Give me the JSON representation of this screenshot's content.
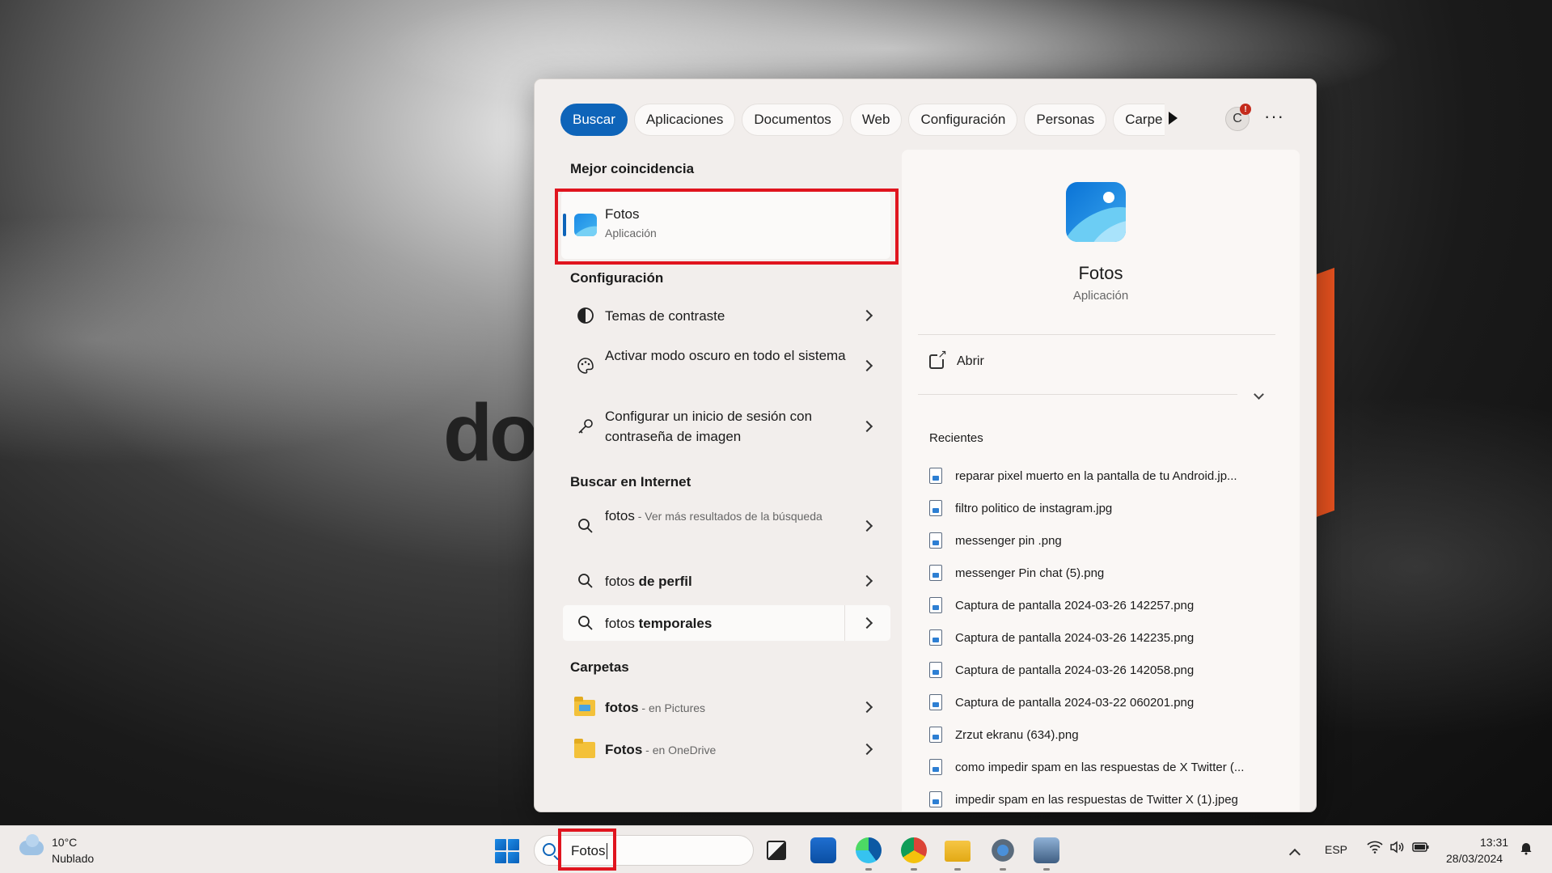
{
  "tabs": [
    {
      "label": "Buscar",
      "active": true
    },
    {
      "label": "Aplicaciones",
      "active": false
    },
    {
      "label": "Documentos",
      "active": false
    },
    {
      "label": "Web",
      "active": false
    },
    {
      "label": "Configuración",
      "active": false
    },
    {
      "label": "Personas",
      "active": false
    },
    {
      "label": "Carpe",
      "active": false
    }
  ],
  "account": {
    "initial": "C",
    "badge": "!"
  },
  "more_label": "···",
  "best_match": {
    "section_title": "Mejor coincidencia",
    "title": "Fotos",
    "subtitle": "Aplicación"
  },
  "settings": {
    "section_title": "Configuración",
    "items": [
      {
        "label": "Temas de contraste",
        "icon": "contrast-icon"
      },
      {
        "label": "Activar modo oscuro en todo el sistema",
        "icon": "palette-icon"
      },
      {
        "label": "Configurar un inicio de sesión con contraseña de imagen",
        "icon": "key-icon"
      }
    ]
  },
  "web": {
    "section_title": "Buscar en Internet",
    "items": [
      {
        "query": "fotos",
        "bold": "",
        "suffix": " - Ver más resultados de la búsqueda"
      },
      {
        "query": "fotos ",
        "bold": "de perfil",
        "suffix": ""
      },
      {
        "query": "fotos ",
        "bold": "temporales",
        "suffix": ""
      }
    ]
  },
  "folders": {
    "section_title": "Carpetas",
    "items": [
      {
        "name": "fotos",
        "location": " - en Pictures"
      },
      {
        "name": "Fotos",
        "location": " - en OneDrive"
      }
    ]
  },
  "detail": {
    "name": "Fotos",
    "type": "Aplicación",
    "open_label": "Abrir",
    "recent_title": "Recientes",
    "recent": [
      "reparar pixel muerto en la pantalla de tu Android.jp...",
      "filtro politico de instagram.jpg",
      "messenger pin .png",
      "messenger Pin chat (5).png",
      "Captura de pantalla 2024-03-26 142257.png",
      "Captura de pantalla 2024-03-26 142235.png",
      "Captura de pantalla 2024-03-26 142058.png",
      "Captura de pantalla 2024-03-22 060201.png",
      "Zrzut ekranu (634).png",
      "como impedir spam en las respuestas de X Twitter (...",
      "impedir spam en las respuestas de Twitter X (1).jpeg"
    ]
  },
  "taskbar": {
    "weather_temp": "10°C",
    "weather_desc": "Nublado",
    "search_value": "Fotos",
    "language": "ESP",
    "time": "13:31",
    "date": "28/03/2024"
  },
  "colors": {
    "accent": "#0e64b9",
    "highlight": "#e0141e"
  }
}
